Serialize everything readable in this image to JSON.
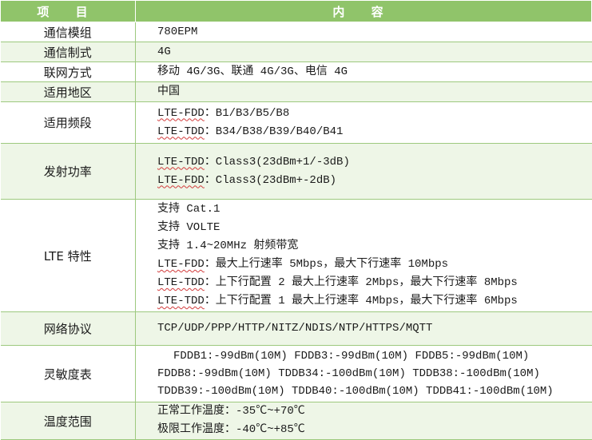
{
  "header": {
    "col_item": "项 目",
    "col_content": "内 容"
  },
  "rows": {
    "module": {
      "key": "通信模组",
      "value": "780EPM"
    },
    "standard": {
      "key": "通信制式",
      "value": "4G"
    },
    "network": {
      "key": "联网方式",
      "value": "移动 4G/3G、联通 4G/3G、电信 4G"
    },
    "region": {
      "key": "适用地区",
      "value": "中国"
    },
    "bands": {
      "key": "适用频段",
      "fdd_prefix": "LTE-FDD",
      "fdd_value": "：B1/B3/B5/B8",
      "tdd_prefix": "LTE-TDD",
      "tdd_value": "：B34/B38/B39/B40/B41"
    },
    "power": {
      "key": "发射功率",
      "tdd_prefix": "LTE-TDD",
      "tdd_value": "：Class3(23dBm+1/-3dB)",
      "fdd_prefix": "LTE-FDD",
      "fdd_value": "：Class3(23dBm+-2dB)"
    },
    "lte": {
      "key": "LTE 特性",
      "line1": "支持 Cat.1",
      "line2": "支持 VOLTE",
      "line3": "支持 1.4~20MHz 射频带宽",
      "fdd_prefix": "LTE-FDD",
      "fdd_value": "：最大上行速率 5Mbps，最大下行速率 10Mbps",
      "tdd2_prefix": "LTE-TDD",
      "tdd2_value": "：上下行配置 2 最大上行速率 2Mbps，最大下行速率 8Mbps",
      "tdd1_prefix": "LTE-TDD",
      "tdd1_value": "：上下行配置 1 最大上行速率 4Mbps，最大下行速率 6Mbps"
    },
    "protocol": {
      "key": "网络协议",
      "value": "TCP/UDP/PPP/HTTP/NITZ/NDIS/NTP/HTTPS/MQTT"
    },
    "sensitivity": {
      "key": "灵敏度表",
      "line1": "FDDB1:-99dBm(10M) FDDB3:-99dBm(10M) FDDB5:-99dBm(10M)",
      "line2": "FDDB8:-99dBm(10M) TDDB34:-100dBm(10M) TDDB38:-100dBm(10M)",
      "line3": "TDDB39:-100dBm(10M) TDDB40:-100dBm(10M) TDDB41:-100dBm(10M)"
    },
    "temperature": {
      "key": "温度范围",
      "line1": "正常工作温度：-35℃~+70℃",
      "line2": "极限工作温度：-40℃~+85℃"
    }
  }
}
